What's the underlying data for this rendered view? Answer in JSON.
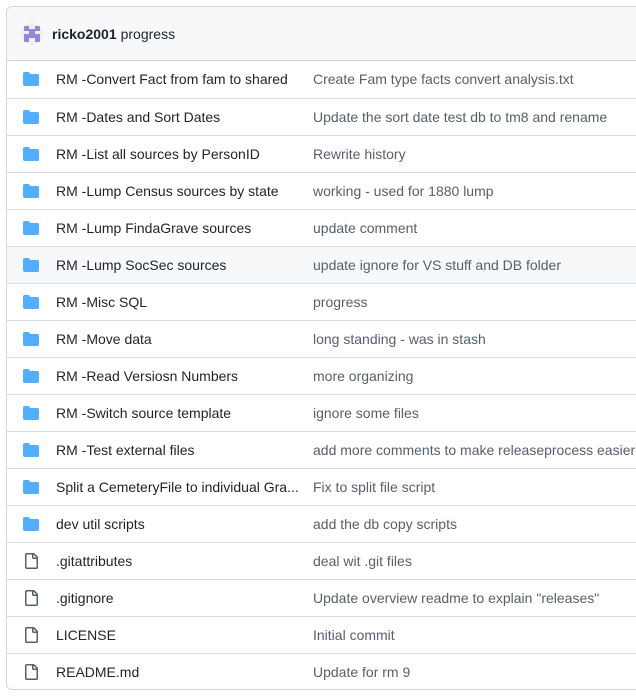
{
  "header": {
    "author": "ricko2001",
    "message": "progress"
  },
  "colors": {
    "folder": "#54aeff",
    "file": "#57606a",
    "border": "#d0d7de",
    "header_bg": "#f6f8fa"
  },
  "files": [
    {
      "type": "folder",
      "icon": "folder-icon",
      "name": "RM -Convert Fact from fam to shared",
      "message": "Create Fam type facts convert analysis.txt"
    },
    {
      "type": "folder",
      "icon": "folder-icon",
      "name": "RM -Dates and Sort Dates",
      "message": "Update the sort date test db to tm8 and rename"
    },
    {
      "type": "folder",
      "icon": "folder-icon",
      "name": "RM -List all sources by PersonID",
      "message": "Rewrite history"
    },
    {
      "type": "folder",
      "icon": "folder-icon",
      "name": "RM -Lump Census sources by state",
      "message": "working - used for 1880 lump"
    },
    {
      "type": "folder",
      "icon": "folder-icon",
      "name": "RM -Lump FindaGrave sources",
      "message": "update comment"
    },
    {
      "type": "folder",
      "icon": "folder-icon",
      "name": "RM -Lump SocSec sources",
      "message": "update ignore for VS stuff and DB folder"
    },
    {
      "type": "folder",
      "icon": "folder-icon",
      "name": "RM -Misc SQL",
      "message": "progress"
    },
    {
      "type": "folder",
      "icon": "folder-icon",
      "name": "RM -Move data",
      "message": "long standing - was in stash"
    },
    {
      "type": "folder",
      "icon": "folder-icon",
      "name": "RM -Read Versiosn Numbers",
      "message": "more organizing"
    },
    {
      "type": "folder",
      "icon": "folder-icon",
      "name": "RM -Switch source template",
      "message": "ignore some files"
    },
    {
      "type": "folder",
      "icon": "folder-icon",
      "name": "RM -Test external files",
      "message": "add more comments to make releaseprocess easier"
    },
    {
      "type": "folder",
      "icon": "folder-icon",
      "name": "Split a CemeteryFile to individual Gra...",
      "message": "Fix to split file script"
    },
    {
      "type": "folder",
      "icon": "folder-icon",
      "name": "dev util scripts",
      "message": "add the db copy scripts"
    },
    {
      "type": "file",
      "icon": "file-icon",
      "name": ".gitattributes",
      "message": "deal wit .git files"
    },
    {
      "type": "file",
      "icon": "file-icon",
      "name": ".gitignore",
      "message": "Update overview readme to explain \"releases\""
    },
    {
      "type": "file",
      "icon": "file-icon",
      "name": "LICENSE",
      "message": "Initial commit"
    },
    {
      "type": "file",
      "icon": "file-icon",
      "name": "README.md",
      "message": "Update for rm 9"
    }
  ],
  "hovered_row": 5
}
